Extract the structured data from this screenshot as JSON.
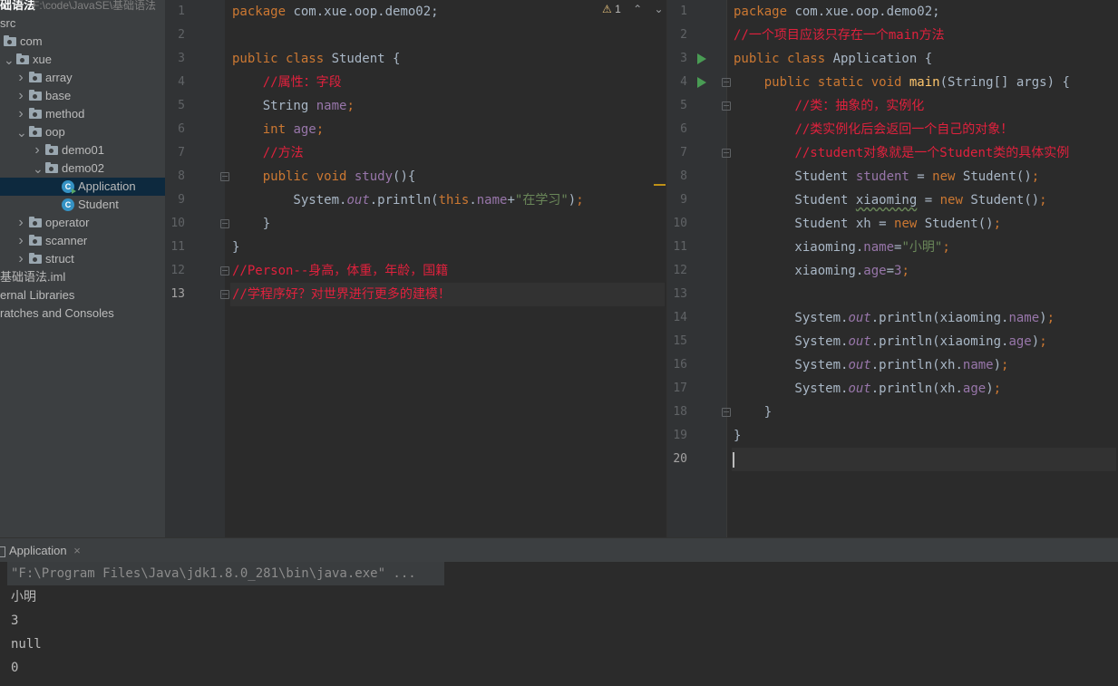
{
  "project": {
    "name": "础语法",
    "path": "F:\\code\\JavaSE\\基础语法"
  },
  "tree": [
    {
      "label": "src",
      "indent": 0,
      "type": "none"
    },
    {
      "label": "com",
      "indent": 0,
      "type": "folder",
      "chev": ""
    },
    {
      "label": "xue",
      "indent": 0,
      "type": "folder",
      "chev": "v"
    },
    {
      "label": "array",
      "indent": 1,
      "type": "folder",
      "chev": ">"
    },
    {
      "label": "base",
      "indent": 1,
      "type": "folder",
      "chev": ">"
    },
    {
      "label": "method",
      "indent": 1,
      "type": "folder",
      "chev": ">"
    },
    {
      "label": "oop",
      "indent": 1,
      "type": "folder",
      "chev": "v"
    },
    {
      "label": "demo01",
      "indent": 2,
      "type": "folder",
      "chev": ">"
    },
    {
      "label": "demo02",
      "indent": 2,
      "type": "folder",
      "chev": "v"
    },
    {
      "label": "Application",
      "indent": 3,
      "type": "class-run",
      "selected": true
    },
    {
      "label": "Student",
      "indent": 3,
      "type": "class"
    },
    {
      "label": "operator",
      "indent": 1,
      "type": "folder",
      "chev": ">"
    },
    {
      "label": "scanner",
      "indent": 1,
      "type": "folder",
      "chev": ">"
    },
    {
      "label": "struct",
      "indent": 1,
      "type": "folder",
      "chev": ">"
    },
    {
      "label": "基础语法.iml",
      "indent": 0,
      "type": "none"
    },
    {
      "label": "ernal Libraries",
      "indent": 0,
      "type": "none"
    },
    {
      "label": "ratches and Consoles",
      "indent": 0,
      "type": "none"
    }
  ],
  "inspection": {
    "icon": "warning-icon",
    "count": "1"
  },
  "left_editor": {
    "current_line": 13,
    "lines": [
      [
        [
          "kw",
          "package "
        ],
        [
          "pl",
          "com.xue.oop.demo02;"
        ]
      ],
      [],
      [
        [
          "kw",
          "public class "
        ],
        [
          "pl",
          "Student {"
        ]
      ],
      [
        [
          "pl",
          "    "
        ],
        [
          "cm",
          "//属性：字段"
        ]
      ],
      [
        [
          "pl",
          "    String "
        ],
        [
          "fld",
          "name"
        ],
        [
          "kw",
          ";"
        ]
      ],
      [
        [
          "pl",
          "    "
        ],
        [
          "kw",
          "int "
        ],
        [
          "fld",
          "age"
        ],
        [
          "kw",
          ";"
        ]
      ],
      [
        [
          "pl",
          "    "
        ],
        [
          "cm",
          "//方法"
        ]
      ],
      [
        [
          "pl",
          "    "
        ],
        [
          "kw",
          "public void "
        ],
        [
          "fld",
          "study"
        ],
        [
          "pl",
          "(){"
        ]
      ],
      [
        [
          "pl",
          "        System."
        ],
        [
          "fld it",
          "out"
        ],
        [
          "pl",
          ".println("
        ],
        [
          "kw",
          "this"
        ],
        [
          "pl",
          "."
        ],
        [
          "fld",
          "name"
        ],
        [
          "pl",
          "+"
        ],
        [
          "st",
          "\"在学习\""
        ],
        [
          "pl",
          ")"
        ],
        [
          "kw",
          ";"
        ]
      ],
      [
        [
          "pl",
          "    }"
        ]
      ],
      [
        [
          "pl",
          "}"
        ]
      ],
      [
        [
          "cm",
          "//Person--身高，体重，年龄，国籍"
        ]
      ],
      [
        [
          "cm",
          "//学程序好？对世界进行更多的建模！"
        ]
      ]
    ]
  },
  "right_editor": {
    "current_line": 20,
    "lines": [
      [
        [
          "kw",
          "package "
        ],
        [
          "pl",
          "com.xue.oop.demo02;"
        ]
      ],
      [
        [
          "cm",
          "//一个项目应该只存在一个main方法"
        ]
      ],
      [
        [
          "kw",
          "public class "
        ],
        [
          "pl",
          "Application {"
        ]
      ],
      [
        [
          "pl",
          "    "
        ],
        [
          "kw",
          "public static void "
        ],
        [
          "fn",
          "main"
        ],
        [
          "pl",
          "(String[] args) {"
        ]
      ],
      [
        [
          "pl",
          "        "
        ],
        [
          "cm",
          "//类：抽象的，实例化"
        ]
      ],
      [
        [
          "pl",
          "        "
        ],
        [
          "cm",
          "//类实例化后会返回一个自己的对象！"
        ]
      ],
      [
        [
          "pl",
          "        "
        ],
        [
          "cm",
          "//student对象就是一个Student类的具体实例"
        ]
      ],
      [
        [
          "pl",
          "        Student "
        ],
        [
          "fld",
          "student"
        ],
        [
          "pl",
          " = "
        ],
        [
          "kw",
          "new "
        ],
        [
          "pl",
          "Student()"
        ],
        [
          "kw",
          ";"
        ]
      ],
      [
        [
          "pl",
          "        Student "
        ],
        [
          "un",
          "xiaoming"
        ],
        [
          "pl",
          " = "
        ],
        [
          "kw",
          "new "
        ],
        [
          "pl",
          "Student()"
        ],
        [
          "kw",
          ";"
        ]
      ],
      [
        [
          "pl",
          "        Student xh = "
        ],
        [
          "kw",
          "new "
        ],
        [
          "pl",
          "Student()"
        ],
        [
          "kw",
          ";"
        ]
      ],
      [
        [
          "pl",
          "        xiaoming."
        ],
        [
          "fld",
          "name"
        ],
        [
          "pl",
          "="
        ],
        [
          "st",
          "\"小明\""
        ],
        [
          "kw",
          ";"
        ]
      ],
      [
        [
          "pl",
          "        xiaoming."
        ],
        [
          "fld",
          "age"
        ],
        [
          "pl",
          "="
        ],
        [
          "fld",
          "3"
        ],
        [
          "kw",
          ";"
        ]
      ],
      [],
      [
        [
          "pl",
          "        System."
        ],
        [
          "fld it",
          "out"
        ],
        [
          "pl",
          ".println(xiaoming."
        ],
        [
          "fld",
          "name"
        ],
        [
          "pl",
          ")"
        ],
        [
          "kw",
          ";"
        ]
      ],
      [
        [
          "pl",
          "        System."
        ],
        [
          "fld it",
          "out"
        ],
        [
          "pl",
          ".println(xiaoming."
        ],
        [
          "fld",
          "age"
        ],
        [
          "pl",
          ")"
        ],
        [
          "kw",
          ";"
        ]
      ],
      [
        [
          "pl",
          "        System."
        ],
        [
          "fld it",
          "out"
        ],
        [
          "pl",
          ".println(xh."
        ],
        [
          "fld",
          "name"
        ],
        [
          "pl",
          ")"
        ],
        [
          "kw",
          ";"
        ]
      ],
      [
        [
          "pl",
          "        System."
        ],
        [
          "fld it",
          "out"
        ],
        [
          "pl",
          ".println(xh."
        ],
        [
          "fld",
          "age"
        ],
        [
          "pl",
          ")"
        ],
        [
          "kw",
          ";"
        ]
      ],
      [
        [
          "pl",
          "    }"
        ]
      ],
      [
        [
          "pl",
          "}"
        ]
      ],
      []
    ]
  },
  "run_panel": {
    "tab_label": "Application",
    "close": "×",
    "output": [
      "\"F:\\Program Files\\Java\\jdk1.8.0_281\\bin\\java.exe\" ...",
      "小明",
      "3",
      "null",
      "0"
    ]
  }
}
